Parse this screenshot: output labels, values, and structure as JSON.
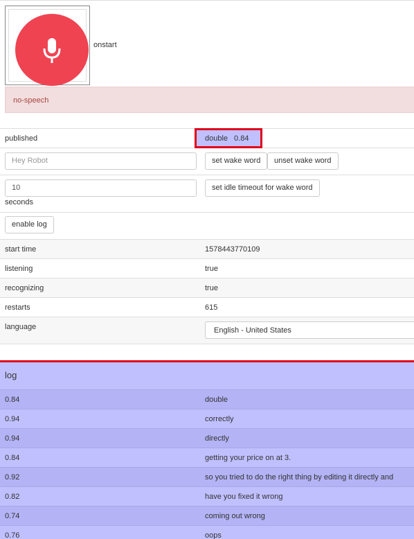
{
  "status": {
    "event_label": "onstart",
    "error_text": "no-speech"
  },
  "published": {
    "label": "published",
    "word": "double",
    "confidence": "0.84"
  },
  "wake_word": {
    "input_placeholder": "Hey Robot",
    "set_button": "set wake word",
    "unset_button": "unset wake word"
  },
  "idle_timeout": {
    "input_value": "10",
    "unit_label": "seconds",
    "button": "set idle timeout for wake word"
  },
  "enable_log_button": "enable log",
  "info": [
    {
      "label": "start time",
      "value": "1578443770109"
    },
    {
      "label": "listening",
      "value": "true"
    },
    {
      "label": "recognizing",
      "value": "true"
    },
    {
      "label": "restarts",
      "value": "615"
    }
  ],
  "language": {
    "label": "language",
    "selected": "English - United States"
  },
  "log": {
    "title": "log",
    "entries": [
      {
        "confidence": "0.84",
        "text": "double"
      },
      {
        "confidence": "0.94",
        "text": "correctly"
      },
      {
        "confidence": "0.94",
        "text": "directly"
      },
      {
        "confidence": "0.84",
        "text": "getting your price on at 3."
      },
      {
        "confidence": "0.92",
        "text": "so you tried to do the right thing by editing it directly and"
      },
      {
        "confidence": "0.82",
        "text": "have you fixed it wrong"
      },
      {
        "confidence": "0.74",
        "text": "coming out wrong"
      },
      {
        "confidence": "0.76",
        "text": "oops"
      }
    ]
  },
  "colors": {
    "mic_button": "#ef4352",
    "alert_bg": "#f2dede",
    "alert_text": "#a94442",
    "highlight_border": "#e0001b",
    "log_bg": "#c0c0ff"
  }
}
